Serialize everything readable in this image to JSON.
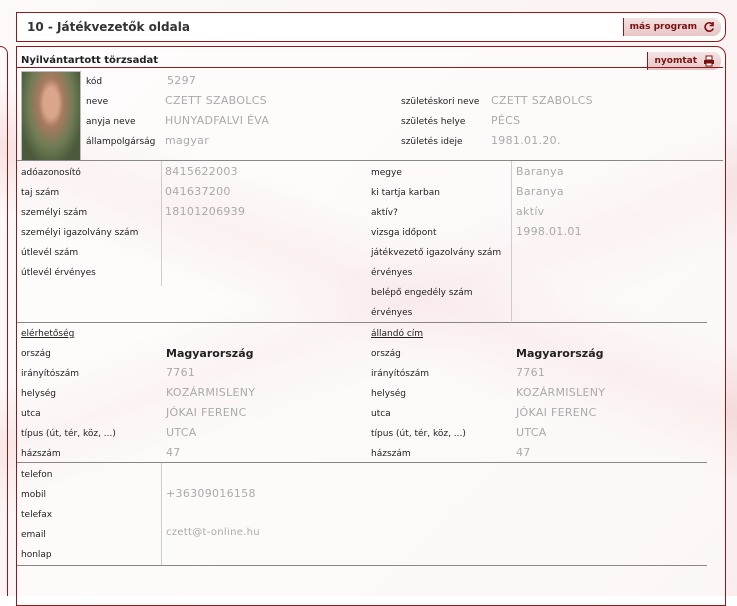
{
  "header": {
    "title": "10 - Játékvezetők oldala",
    "other_program_label": "más program"
  },
  "panel": {
    "title": "Nyilvántartott törzsadat",
    "print_label": "nyomtat"
  },
  "person": {
    "left": [
      {
        "label": "kód",
        "value": "5297"
      },
      {
        "label": "neve",
        "value": "CZETT SZABOLCS"
      },
      {
        "label": "anyja neve",
        "value": "HUNYADFALVI ÉVA"
      },
      {
        "label": "állampolgárság",
        "value": "magyar"
      }
    ],
    "right": [
      {
        "label": "születéskori neve",
        "value": "CZETT SZABOLCS"
      },
      {
        "label": "születés helye",
        "value": "PÉCS"
      },
      {
        "label": "születés ideje",
        "value": "1981.01.20."
      }
    ]
  },
  "ids": {
    "left": [
      {
        "label": "adóazonosító",
        "value": "8415622003"
      },
      {
        "label": "taj szám",
        "value": "041637200"
      },
      {
        "label": "személyi szám",
        "value": "18101206939"
      },
      {
        "label": "személyi igazolvány szám",
        "value": ""
      },
      {
        "label": "útlevél szám",
        "value": ""
      },
      {
        "label": "útlevél érvényes",
        "value": ""
      }
    ],
    "right": [
      {
        "label": "megye",
        "value": "Baranya"
      },
      {
        "label": "ki tartja karban",
        "value": "Baranya"
      },
      {
        "label": "aktív?",
        "value": "aktív"
      },
      {
        "label": "vizsga időpont",
        "value": "1998.01.01"
      },
      {
        "label": "játékvezető igazolvány szám",
        "value": ""
      },
      {
        "label": "érvényes",
        "value": ""
      },
      {
        "label": "belépő engedély szám",
        "value": ""
      },
      {
        "label": "érvényes",
        "value": ""
      }
    ]
  },
  "contact_title": "elérhetőség",
  "permanent_title": "állandó cím",
  "contact": [
    {
      "label": "ország",
      "value": "Magyarország"
    },
    {
      "label": "irányítószám",
      "value": "7761"
    },
    {
      "label": "helység",
      "value": "KOZÁRMISLENY"
    },
    {
      "label": "utca",
      "value": "JÓKAI FERENC"
    },
    {
      "label": "típus (út, tér, köz, ...)",
      "value": "UTCA"
    },
    {
      "label": "házszám",
      "value": "47"
    }
  ],
  "permanent": [
    {
      "label": "ország",
      "value": "Magyarország"
    },
    {
      "label": "irányítószám",
      "value": "7761"
    },
    {
      "label": "helység",
      "value": "KOZÁRMISLENY"
    },
    {
      "label": "utca",
      "value": "JÓKAI FERENC"
    },
    {
      "label": "típus (út, tér, köz, ...)",
      "value": "UTCA"
    },
    {
      "label": "házszám",
      "value": "47"
    }
  ],
  "phones": [
    {
      "label": "telefon",
      "value": ""
    },
    {
      "label": "mobil",
      "value": "+36309016158"
    },
    {
      "label": "telefax",
      "value": ""
    },
    {
      "label": "email",
      "value": "czett@t-online.hu"
    },
    {
      "label": "honlap",
      "value": ""
    }
  ],
  "colors": {
    "accent": "#8e1b1b",
    "button_bg": "#ecd2d2"
  },
  "icons": {
    "refresh": "refresh-icon",
    "print": "printer-icon"
  }
}
